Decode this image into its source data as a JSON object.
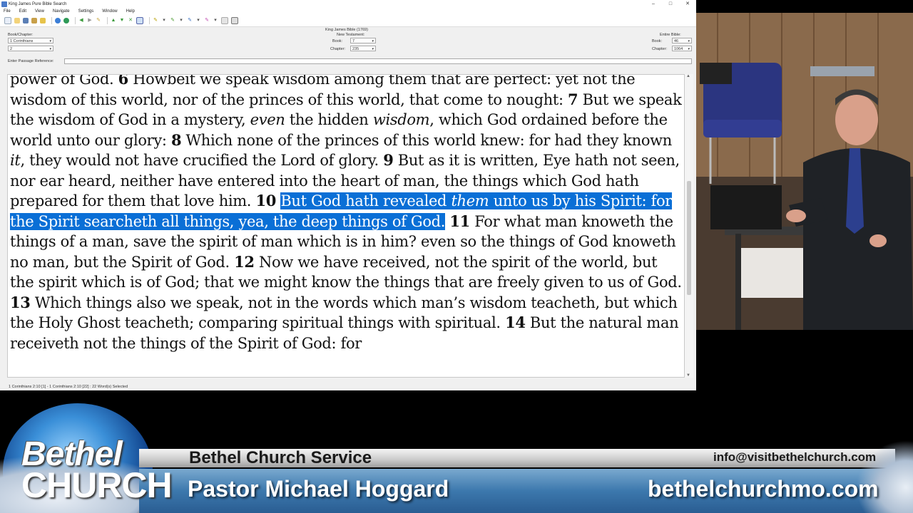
{
  "window": {
    "title": "King James Pure Bible Search",
    "min": "–",
    "max": "□",
    "close": "✕"
  },
  "menu": [
    "File",
    "Edit",
    "View",
    "Navigate",
    "Settings",
    "Window",
    "Help"
  ],
  "nav": {
    "bible_name": "King James Bible (1769)",
    "book_chapter_label": "Book/Chapter:",
    "book_value": "1 Corinthians",
    "chapter_value": "2",
    "testament_label": "New Testament:",
    "nt_book_label": "Book:",
    "nt_book_value": "7",
    "nt_chapter_label": "Chapter:",
    "nt_chapter_value": "235",
    "entire_label": "Entire Bible:",
    "eb_book_label": "Book:",
    "eb_book_value": "46",
    "eb_chapter_label": "Chapter:",
    "eb_chapter_value": "1064",
    "passage_label": "Enter Passage Reference:"
  },
  "passage": {
    "s1": "power of God.",
    "v6": "6",
    "s2": "Howbeit we speak wisdom among them that are perfect: yet not the wisdom of this world, nor of the princes of this world, that come to nought:",
    "v7": "7",
    "s3": "But we speak the wisdom of God in a mystery,",
    "i1": "even",
    "s4": "the hidden",
    "i2": "wisdom",
    "s5": ", which God ordained before the world unto our glory:",
    "v8": "8",
    "s6": "Which none of the princes of this world knew: for had they known",
    "i3": "it",
    "s7": ", they would not have crucified the Lord of glory.",
    "v9": "9",
    "s8": "But as it is written, Eye hath not seen, nor ear heard, neither have entered into the heart of man, the things which God hath prepared for them that love him.",
    "v10": "10",
    "h1": "But God hath revealed",
    "hi": "them",
    "h2": "unto us by his Spirit: for the Spirit searcheth all things, yea, the deep things of God.",
    "v11": "11",
    "s9": "For what man knoweth the things of a man, save the spirit of man which is in him? even so the things of God knoweth no man, but the Spirit of God.",
    "v12": "12",
    "s10": "Now we have received, not the spirit of the world, but the spirit which is of God; that we might know the things that are freely given to us of God.",
    "v13": "13",
    "s11": "Which things also we speak, not in the words which man’s wisdom teacheth, but which the Holy Ghost teacheth; comparing spiritual things with spiritual.",
    "v14": "14",
    "s12": "But the natural man receiveth not the things of the Spirit of God: for"
  },
  "status": "1 Corinthians 2:10 [1] - 1 Corinthians 2:10 [22] : 22 Word(s) Selected",
  "banner": {
    "logo_top": "Bethel",
    "logo_bottom": "CHURCH",
    "service": "Bethel Church Service",
    "email": "info@visitbethelchurch.com",
    "pastor": "Pastor Michael Hoggard",
    "site": "bethelchurchmo.com"
  },
  "colors": {
    "highlight": "#0a6fd6",
    "banner_blue": "#3c78ad"
  }
}
